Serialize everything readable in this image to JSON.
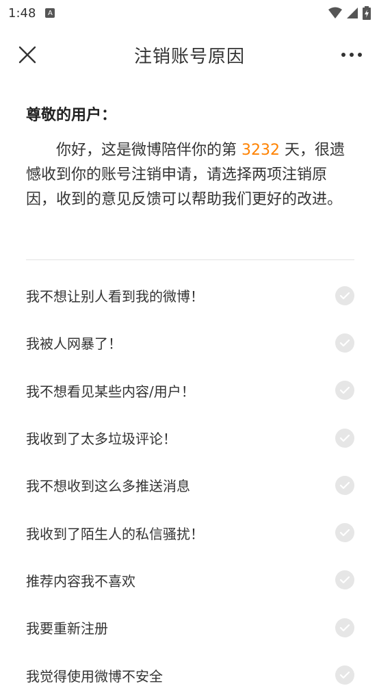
{
  "status_bar": {
    "time": "1:48",
    "notification_icon": "A",
    "icons": [
      "wifi-icon",
      "signal-icon",
      "battery-icon"
    ]
  },
  "header": {
    "title": "注销账号原因",
    "close_icon": "close-icon",
    "more_icon": "more-icon"
  },
  "intro": {
    "greeting": "尊敬的用户：",
    "text_before": "你好，这是微博陪伴你的第 ",
    "days": "3232",
    "text_after": " 天，很遗憾收到你的账号注销申请，请选择两项注销原因，收到的意见反馈可以帮助我们更好的改进。"
  },
  "reasons": [
    {
      "label": "我不想让别人看到我的微博！"
    },
    {
      "label": "我被人网暴了！"
    },
    {
      "label": "我不想看见某些内容/用户！"
    },
    {
      "label": "我收到了太多垃圾评论！"
    },
    {
      "label": "我不想收到这么多推送消息"
    },
    {
      "label": "我收到了陌生人的私信骚扰！"
    },
    {
      "label": "推荐内容我不喜欢"
    },
    {
      "label": "我要重新注册"
    },
    {
      "label": "我觉得使用微博不安全"
    }
  ],
  "colors": {
    "accent": "#ff8200",
    "check_bg": "#e6e6e6",
    "divider": "#e2e2e2"
  }
}
